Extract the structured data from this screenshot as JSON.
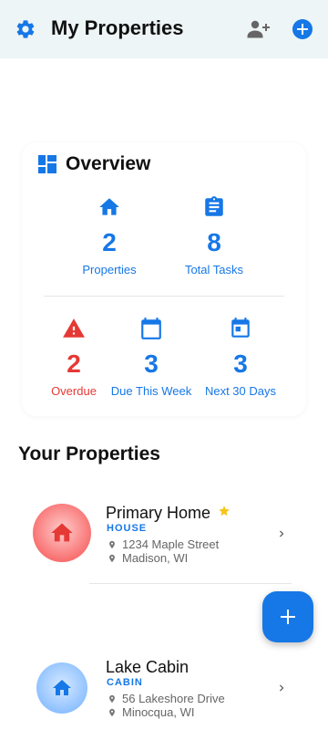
{
  "appbar": {
    "title": "My Properties"
  },
  "overview": {
    "title": "Overview",
    "stats_top": [
      {
        "value": "2",
        "label": "Properties",
        "icon": "home-icon"
      },
      {
        "value": "8",
        "label": "Total Tasks",
        "icon": "clipboard-icon"
      }
    ],
    "stats_bottom": [
      {
        "value": "2",
        "label": "Overdue",
        "icon": "warning-icon"
      },
      {
        "value": "3",
        "label": "Due This Week",
        "icon": "calendar-icon"
      },
      {
        "value": "3",
        "label": "Next 30 Days",
        "icon": "calendar-event-icon"
      }
    ]
  },
  "properties_section": {
    "title": "Your Properties"
  },
  "properties": [
    {
      "name": "Primary Home",
      "type": "HOUSE",
      "street": "1234 Maple Street",
      "city": "Madison, WI",
      "favorite": true
    },
    {
      "name": "Lake Cabin",
      "type": "CABIN",
      "street": "56 Lakeshore Drive",
      "city": "Minocqua, WI",
      "favorite": false
    }
  ],
  "colors": {
    "accent": "#1677e6",
    "danger": "#e53935",
    "star": "#f5c518",
    "appbar_bg": "#eef5f6"
  }
}
